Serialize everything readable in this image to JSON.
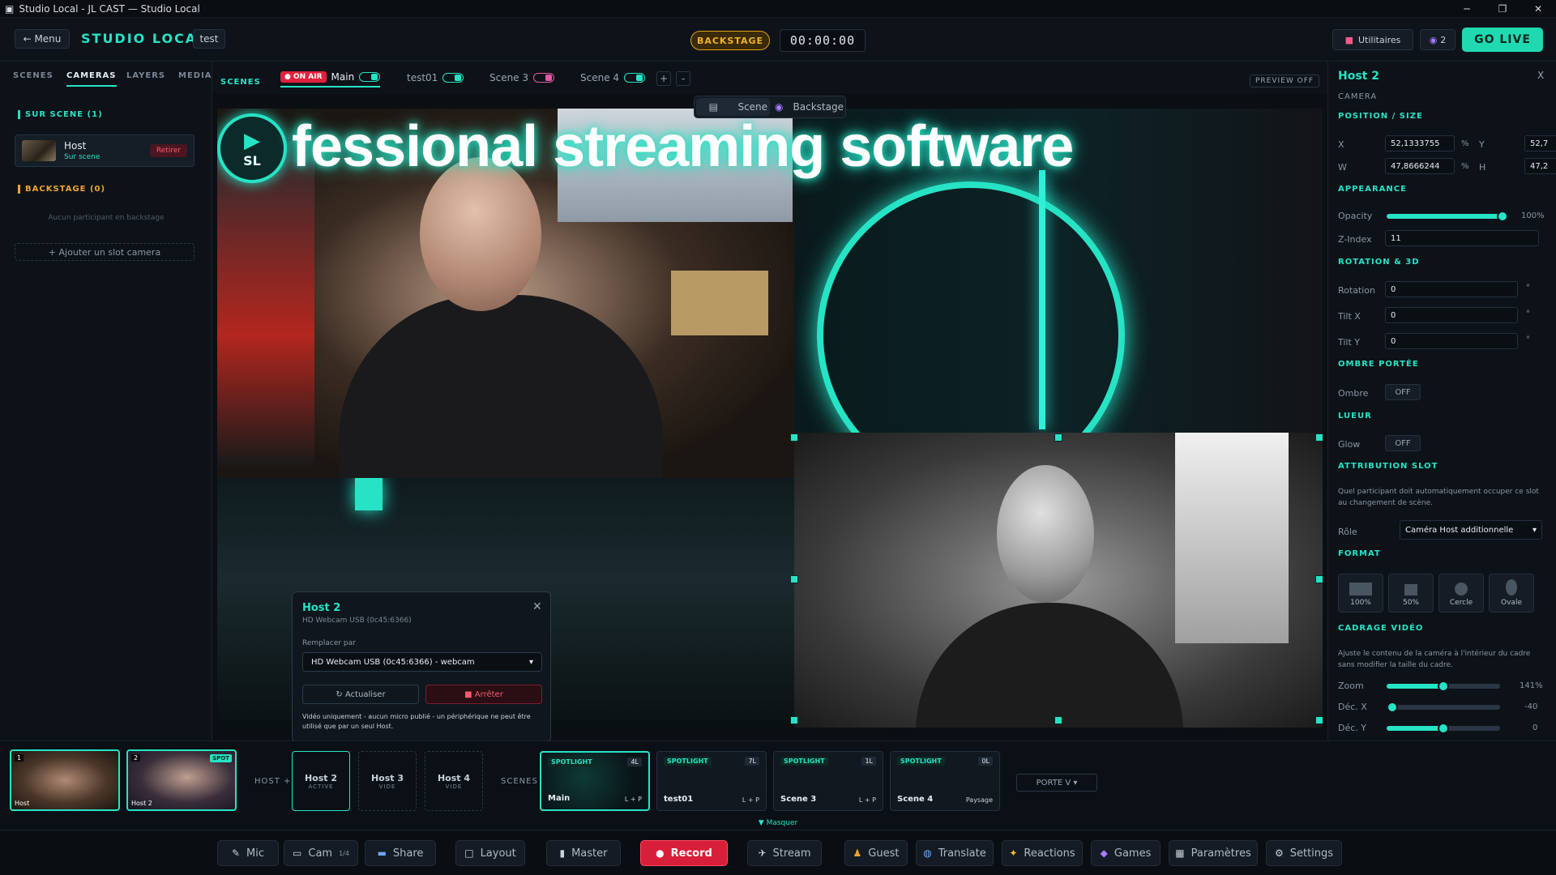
{
  "titlebar": {
    "title": "Studio Local - JL CAST — Studio Local"
  },
  "header": {
    "menu_label": "← Menu",
    "studio_title": "STUDIO LOCAL",
    "studio_name": "test",
    "backstage_label": "BACKSTAGE",
    "timer": "00:00:00",
    "utils_label": "Utilitaires",
    "viewers_count": "2",
    "golive_label": "GO LIVE"
  },
  "left_panel": {
    "tabs": [
      {
        "label": "SCENES"
      },
      {
        "label": "CAMERAS"
      },
      {
        "label": "LAYERS"
      },
      {
        "label": "MEDIA"
      }
    ],
    "on_scene_title": "SUR SCENE (1)",
    "host": {
      "name": "Host",
      "status": "Sur scene",
      "remove_label": "Retirer"
    },
    "backstage_title": "BACKSTAGE (0)",
    "backstage_empty": "Aucun participant en backstage",
    "add_slot_label": "+ Ajouter un slot camera"
  },
  "scene_bar": {
    "label": "SCENES",
    "on_air_label": "● ON AIR",
    "scenes": [
      {
        "name": "Main"
      },
      {
        "name": "test01"
      },
      {
        "name": "Scene 3"
      },
      {
        "name": "Scene 4"
      }
    ],
    "add_label": "+",
    "remove_label": "-",
    "preview_label": "PREVIEW OFF"
  },
  "canvas": {
    "banner_text": "fessional streaming software",
    "banner_logo_text": "SL",
    "view_toggle": {
      "scene_label": "Scene",
      "backstage_label": "Backstage"
    }
  },
  "camera_popup": {
    "title": "Host 2",
    "device": "HD Webcam USB (0c45:6366)",
    "replace_label": "Remplacer par",
    "select_value": "HD Webcam USB (0c45:6366) - webcam",
    "refresh_label": "↻ Actualiser",
    "stop_label": "■ Arrêter",
    "note": "Vidéo uniquement - aucun micro publié - un périphérique ne peut être utilisé que par un seul Host."
  },
  "right_panel": {
    "title": "Host 2",
    "close": "X",
    "subtitle": "CAMERA",
    "position_title": "POSITION / SIZE",
    "x_label": "X",
    "x_value": "52,1333755",
    "y_label": "Y",
    "y_value": "52,7",
    "w_label": "W",
    "w_value": "47,8666244",
    "h_label": "H",
    "h_value": "47,2",
    "pct": "%",
    "appearance_title": "APPEARANCE",
    "opacity_label": "Opacity",
    "opacity_value": "100%",
    "opacity_level": 1.0,
    "zindex_label": "Z-Index",
    "zindex_value": "11",
    "rotation_title": "ROTATION & 3D",
    "rotation_label": "Rotation",
    "rotation_value": "0",
    "tiltx_label": "Tilt X",
    "tiltx_value": "0",
    "tilty_label": "Tilt Y",
    "tilty_value": "0",
    "deg": "°",
    "shadow_title": "OMBRE PORTÉE",
    "shadow_label": "Ombre",
    "shadow_value": "OFF",
    "glow_title": "LUEUR",
    "glow_label": "Glow",
    "glow_value": "OFF",
    "slot_title": "ATTRIBUTION SLOT",
    "slot_desc": "Quel participant doit automatiquement occuper ce slot au changement de scène.",
    "role_label": "Rôle",
    "role_value": "Caméra Host additionnelle",
    "format_title": "FORMAT",
    "formats": [
      {
        "label": "100%"
      },
      {
        "label": "50%"
      },
      {
        "label": "Cercle"
      },
      {
        "label": "Ovale"
      }
    ],
    "crop_title": "CADRAGE VIDÉO",
    "crop_desc": "Ajuste le contenu de la caméra à l'intérieur du cadre sans modifier la taille du cadre.",
    "zoom_label": "Zoom",
    "zoom_value": "141%",
    "zoom_level": 0.5,
    "decx_label": "Déc. X",
    "decx_value": "-40",
    "decx_level": 0.05,
    "decy_label": "Déc. Y",
    "decy_value": "0",
    "decy_level": 0.5
  },
  "strip": {
    "thumbs": [
      {
        "num": "1",
        "caption": "Host"
      },
      {
        "num": "2",
        "caption": "Host 2",
        "badge": "SPOT"
      }
    ],
    "host_label": "HOST +",
    "slots": [
      {
        "name": "Host 2",
        "state": "ACTIVE"
      },
      {
        "name": "Host 3",
        "state": "VIDE"
      },
      {
        "name": "Host 4",
        "state": "VIDE"
      }
    ],
    "scenes_label": "SCENES",
    "scene_cards": [
      {
        "tag": "SPOTLIGHT",
        "count": "4L",
        "name": "Main",
        "layout": "L + P"
      },
      {
        "tag": "SPOTLIGHT",
        "count": "7L",
        "name": "test01",
        "layout": "L + P"
      },
      {
        "tag": "SPOTLIGHT",
        "count": "1L",
        "name": "Scene 3",
        "layout": "L + P"
      },
      {
        "tag": "SPOTLIGHT",
        "count": "0L",
        "name": "Scene 4",
        "layout": "Paysage"
      }
    ],
    "porte_label": "PORTE V ▾",
    "hide_label": "▼ Masquer"
  },
  "toolbar": {
    "items": [
      {
        "label": "Mic"
      },
      {
        "label": "Cam",
        "extra": "1/4"
      },
      {
        "label": "Share"
      },
      {
        "label": "Layout"
      },
      {
        "label": "Master"
      },
      {
        "label": "Record"
      },
      {
        "label": "Stream"
      },
      {
        "label": "Guest"
      },
      {
        "label": "Translate"
      },
      {
        "label": "Reactions"
      },
      {
        "label": "Games"
      },
      {
        "label": "Paramètres"
      },
      {
        "label": "Settings"
      }
    ]
  },
  "colors": {
    "accent": "#27e3c5",
    "record": "#d81f3a",
    "backstage": "#f0b429"
  }
}
